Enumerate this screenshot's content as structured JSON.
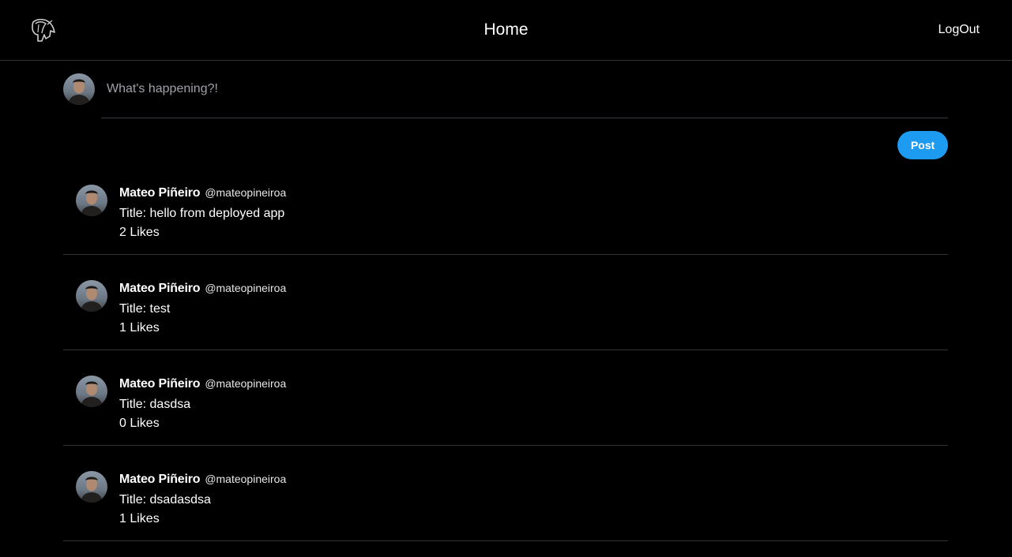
{
  "header": {
    "logo_icon": "spartan-helmet-icon",
    "title": "Home",
    "logout_label": "LogOut"
  },
  "composer": {
    "avatar_icon": "user-avatar",
    "placeholder": "What's happening?!",
    "value": "",
    "post_label": "Post",
    "accent_color": "#1d9bf0"
  },
  "posts": [
    {
      "name": "Mateo Piñeiro",
      "handle": "@mateopineiroa",
      "title": "Title: hello from deployed app",
      "likes": "2 Likes"
    },
    {
      "name": "Mateo Piñeiro",
      "handle": "@mateopineiroa",
      "title": "Title: test",
      "likes": "1 Likes"
    },
    {
      "name": "Mateo Piñeiro",
      "handle": "@mateopineiroa",
      "title": "Title: dasdsa",
      "likes": "0 Likes"
    },
    {
      "name": "Mateo Piñeiro",
      "handle": "@mateopineiroa",
      "title": "Title: dsadasdsa",
      "likes": "1 Likes"
    }
  ]
}
